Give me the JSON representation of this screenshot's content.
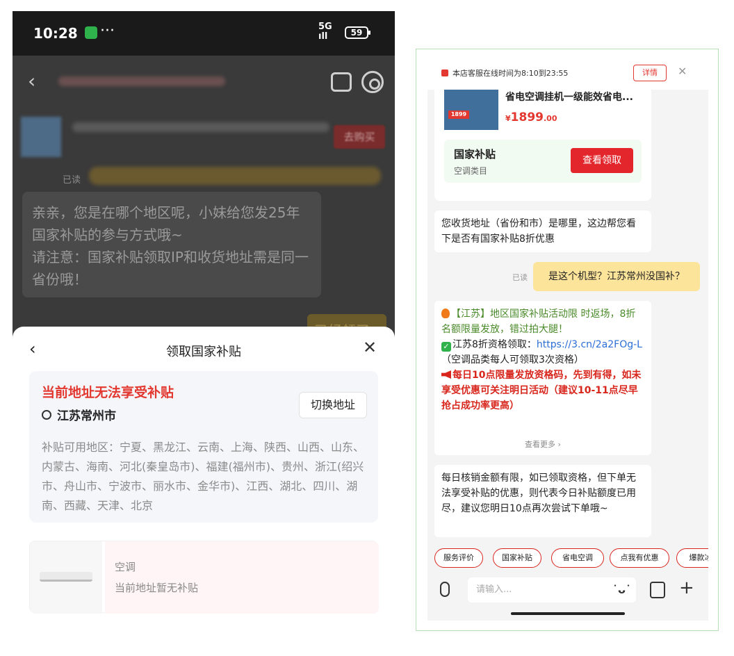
{
  "left": {
    "status": {
      "time": "10:28",
      "dots": "···",
      "network": "5G",
      "battery": "59"
    },
    "chat": {
      "read": "已读",
      "buy_button": "去购买",
      "message": "亲亲，您是在哪个地区呢，小妹给您发25年国家补贴的参与方式哦~\n请注意：国家补贴领取IP和收货地址需是同一省份哦！",
      "claimed": "已经领了"
    },
    "sheet": {
      "title": "领取国家补贴",
      "warning": "当前地址无法享受补贴",
      "city": "江苏常州市",
      "switch_label": "切换地址",
      "regions": "补贴可用地区：宁夏、黑龙江、云南、上海、陕西、山西、山东、内蒙古、海南、河北(秦皇岛市)、福建(福州市)、贵州、浙江(绍兴市、舟山市、宁波市、丽水市、金华市)、江西、湖北、四川、湖南、西藏、天津、北京",
      "item_category": "空调",
      "item_status": "当前地址暂无补贴"
    }
  },
  "right": {
    "notice": {
      "text": "本店客服在线时间为8:10到23:55",
      "detail": "详情"
    },
    "product": {
      "name": "省电空调挂机一级能效省电...",
      "price_symbol": "¥",
      "price_int": "1899",
      "price_dec": ".00",
      "img_badge": "1899"
    },
    "subsidy": {
      "title": "国家补贴",
      "sub": "空调类目",
      "button": "查看领取"
    },
    "msg1": "您收货地址（省份和市）是哪里，这边帮您看下是否有国家补贴8折优惠",
    "read": "已读",
    "msg2": "是这个机型？江苏常州没国补？",
    "msg3": {
      "line1": "【江苏】地区国家补贴活动限 时返场，8折名额限量发放，错过拍大腿！",
      "line2a": "江苏8折资格领取：",
      "link": "https://3.cn/2a2FOg-L",
      "line2b": "（空调品类每人可领取3次资格）",
      "line3": "每日10点限量发放资格码，先到有得，如未享受优惠可关注明日活动（建议10-11点尽早抢占成功率更高）",
      "more": "查看更多 ›"
    },
    "msg4": "每日核销金额有限，如已领取资格，但下单无法享受补贴的优惠，则代表今日补贴额度已用尽，建议您明日10点再次尝试下单哦~",
    "quick": [
      "服务评价",
      "国家补贴",
      "省电空调",
      "点我有优惠",
      "爆款冰"
    ],
    "input_placeholder": "请输入..."
  }
}
